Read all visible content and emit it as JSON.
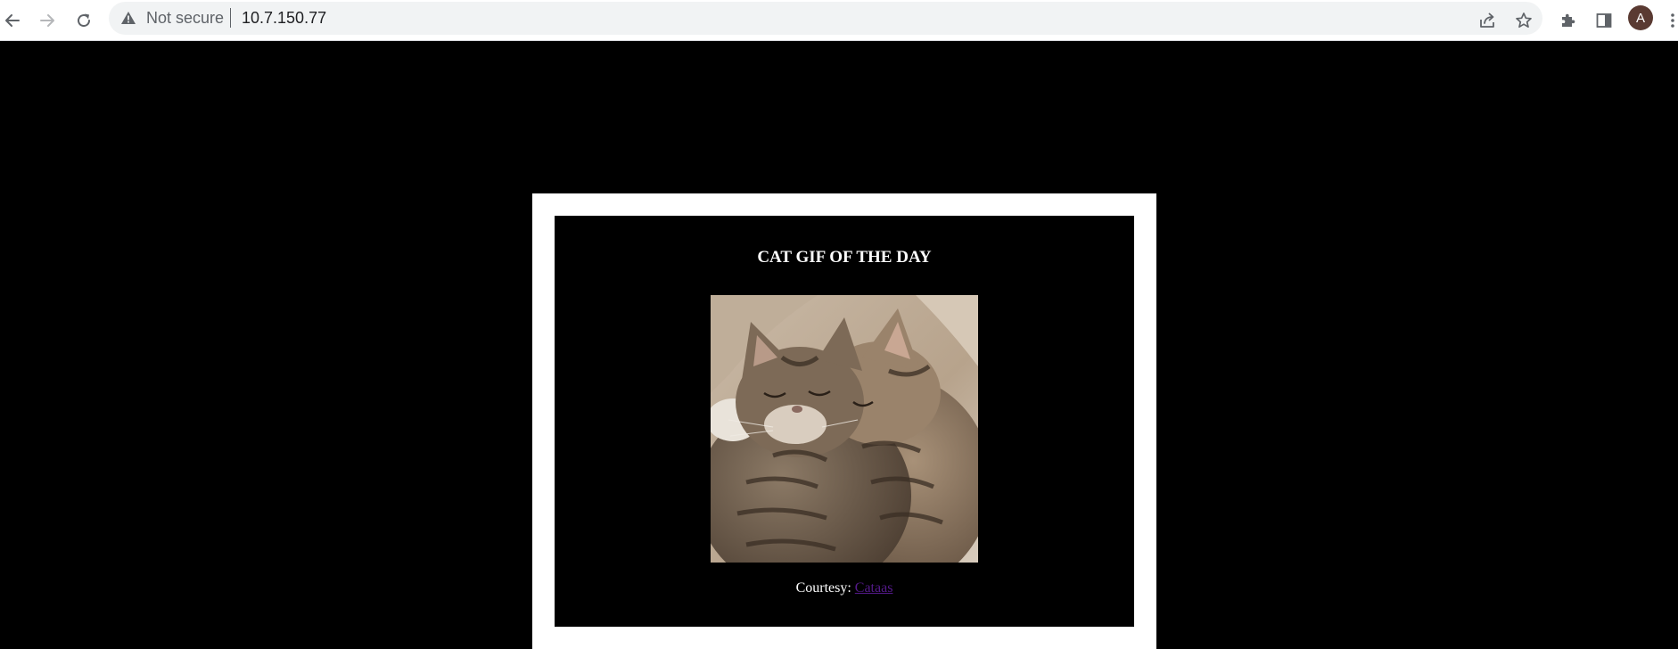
{
  "browser": {
    "address_bar": {
      "security_label": "Not secure",
      "url": "10.7.150.77"
    },
    "profile": {
      "initial": "A",
      "color": "#5a3a32"
    },
    "icons": {
      "back": "back-arrow-icon",
      "forward": "forward-arrow-icon",
      "reload": "reload-icon",
      "warning": "warning-triangle-icon",
      "share": "share-icon",
      "bookmark": "star-icon",
      "extensions": "puzzle-icon",
      "side_panel": "side-panel-icon",
      "menu": "kebab-menu-icon"
    }
  },
  "page": {
    "background": "#000000",
    "frame_color": "#ffffff",
    "heading": "CAT GIF OF THE DAY",
    "image": {
      "subject": "two tabby kittens cuddling and sleeping"
    },
    "courtesy_prefix": "Courtesy: ",
    "courtesy_link": "Cataas",
    "link_color": "#551a8b"
  }
}
